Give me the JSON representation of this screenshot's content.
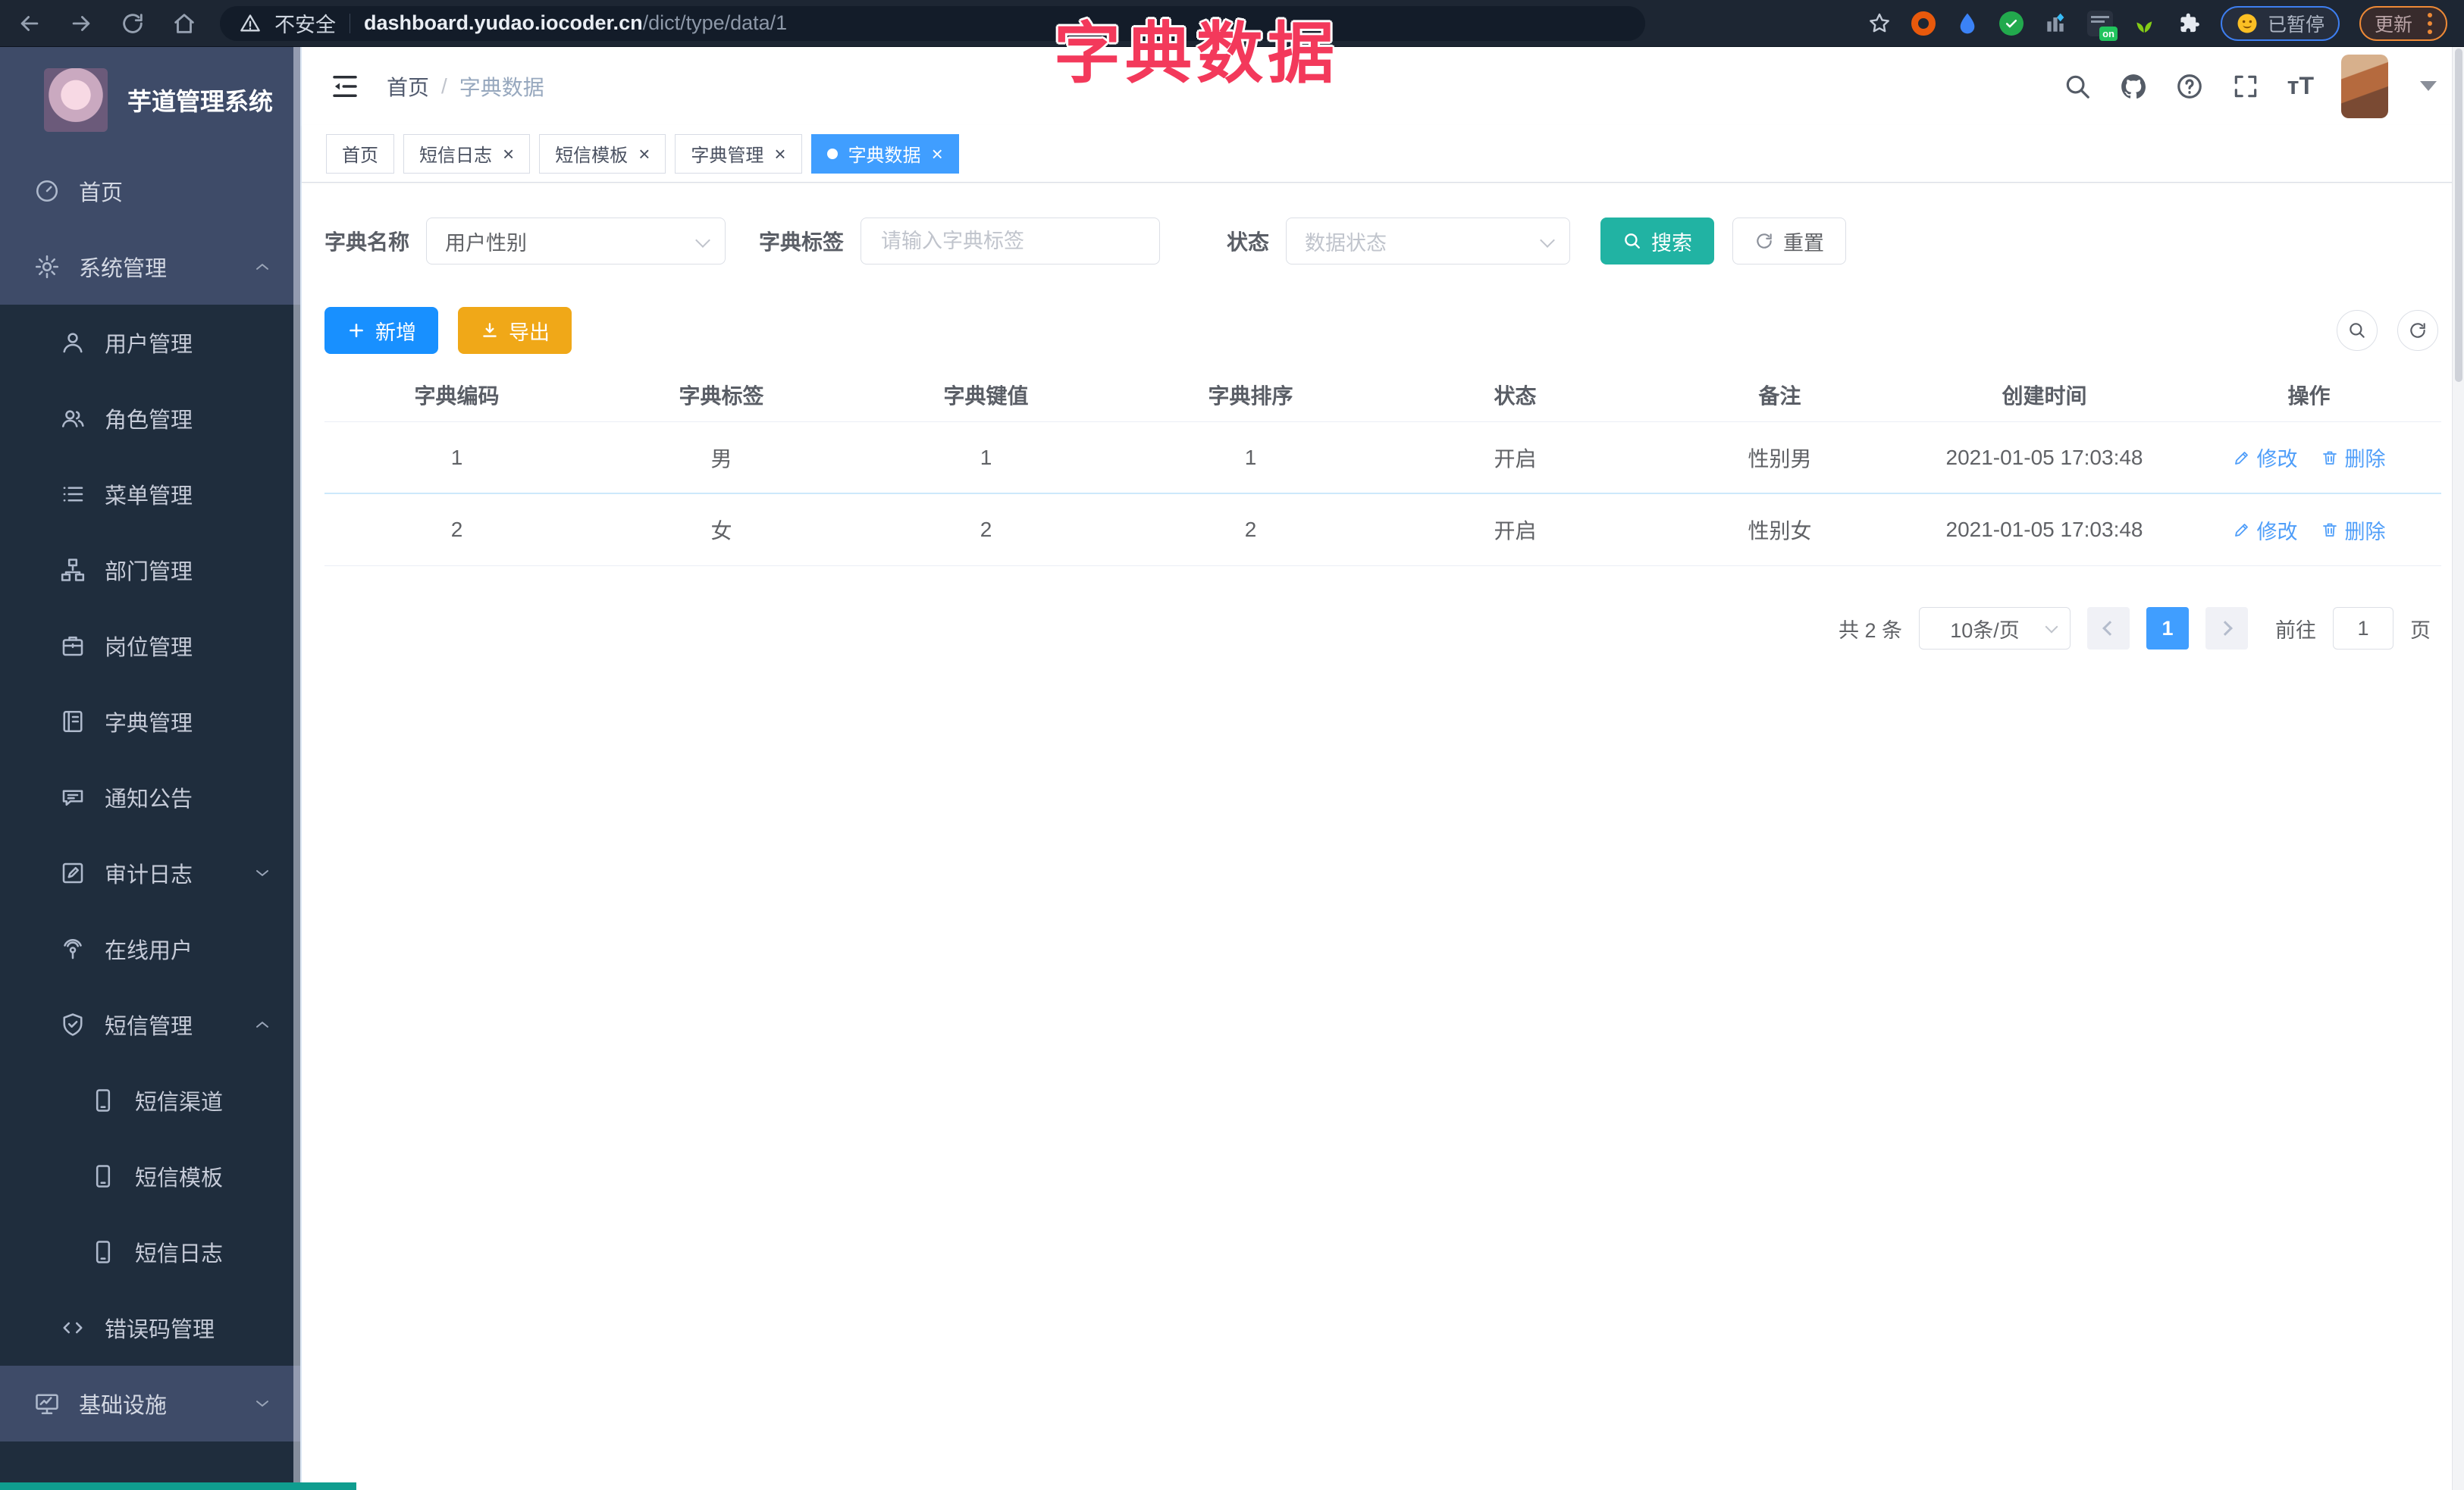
{
  "browser": {
    "security_label": "不安全",
    "url_domain": "dashboard.yudao.iocoder.cn",
    "url_path": "/dict/type/data/1",
    "paused_label": "已暂停",
    "update_label": "更新"
  },
  "overlay": {
    "title": "字典数据",
    "color": "#f3395b"
  },
  "sidebar": {
    "logo_title": "芋道管理系统",
    "items": [
      {
        "id": "home",
        "label": "首页",
        "icon": "gauge",
        "level": 1,
        "chevron": ""
      },
      {
        "id": "system-mgmt",
        "label": "系统管理",
        "icon": "gear",
        "level": 1,
        "chevron": "up"
      },
      {
        "id": "user-mgmt",
        "label": "用户管理",
        "icon": "user",
        "level": 2,
        "chevron": ""
      },
      {
        "id": "role-mgmt",
        "label": "角色管理",
        "icon": "users",
        "level": 2,
        "chevron": ""
      },
      {
        "id": "menu-mgmt",
        "label": "菜单管理",
        "icon": "list",
        "level": 2,
        "chevron": ""
      },
      {
        "id": "dept-mgmt",
        "label": "部门管理",
        "icon": "tree",
        "level": 2,
        "chevron": ""
      },
      {
        "id": "post-mgmt",
        "label": "岗位管理",
        "icon": "post",
        "level": 2,
        "chevron": ""
      },
      {
        "id": "dict-mgmt",
        "label": "字典管理",
        "icon": "dict",
        "level": 2,
        "chevron": ""
      },
      {
        "id": "notice",
        "label": "通知公告",
        "icon": "notice",
        "level": 2,
        "chevron": ""
      },
      {
        "id": "audit-log",
        "label": "审计日志",
        "icon": "audit",
        "level": 2,
        "chevron": "down"
      },
      {
        "id": "online-user",
        "label": "在线用户",
        "icon": "online",
        "level": 2,
        "chevron": ""
      },
      {
        "id": "sms-mgmt",
        "label": "短信管理",
        "icon": "sms",
        "level": 2,
        "chevron": "up"
      },
      {
        "id": "sms-channel",
        "label": "短信渠道",
        "icon": "phone",
        "level": 3,
        "chevron": ""
      },
      {
        "id": "sms-template",
        "label": "短信模板",
        "icon": "phone",
        "level": 3,
        "chevron": ""
      },
      {
        "id": "sms-log",
        "label": "短信日志",
        "icon": "phone",
        "level": 3,
        "chevron": ""
      },
      {
        "id": "errcode-mgmt",
        "label": "错误码管理",
        "icon": "code",
        "level": 2,
        "chevron": ""
      },
      {
        "id": "infrastructure",
        "label": "基础设施",
        "icon": "infra",
        "level": 1,
        "chevron": "down"
      }
    ]
  },
  "header": {
    "breadcrumb_home": "首页",
    "breadcrumb_sep": "/",
    "breadcrumb_current": "字典数据"
  },
  "tabs": {
    "items": [
      {
        "id": "home",
        "label": "首页",
        "closable": false,
        "active": false
      },
      {
        "id": "sms-log",
        "label": "短信日志",
        "closable": true,
        "active": false
      },
      {
        "id": "sms-template",
        "label": "短信模板",
        "closable": true,
        "active": false
      },
      {
        "id": "dict-mgmt",
        "label": "字典管理",
        "closable": true,
        "active": false
      },
      {
        "id": "dict-data",
        "label": "字典数据",
        "closable": true,
        "active": true
      }
    ]
  },
  "filters": {
    "dict_name_label": "字典名称",
    "dict_name_value": "用户性别",
    "dict_label_label": "字典标签",
    "dict_label_placeholder": "请输入字典标签",
    "status_label": "状态",
    "status_placeholder": "数据状态",
    "search_label": "搜索",
    "reset_label": "重置"
  },
  "toolbar": {
    "add_label": "新增",
    "export_label": "导出"
  },
  "table": {
    "columns": [
      "字典编码",
      "字典标签",
      "字典键值",
      "字典排序",
      "状态",
      "备注",
      "创建时间",
      "操作"
    ],
    "rows": [
      [
        "1",
        "男",
        "1",
        "1",
        "开启",
        "性别男",
        "2021-01-05 17:03:48"
      ],
      [
        "2",
        "女",
        "2",
        "2",
        "开启",
        "性别女",
        "2021-01-05 17:03:48"
      ]
    ],
    "edit_label": "修改",
    "delete_label": "删除"
  },
  "pagination": {
    "total_label": "共 2 条",
    "page_size": "10条/页",
    "current_page": "1",
    "goto_label": "前往",
    "goto_value": "1",
    "page_unit": "页"
  },
  "colors": {
    "accent_blue": "#1890ff",
    "active_tab_blue": "#409eff",
    "teal_search": "#21b3a3",
    "export_orange": "#f0a818",
    "overlay_red": "#f3395b",
    "sidebar_dark": "#1f2d3d",
    "sidebar_light": "#3e4b68",
    "link_blue": "#4f9ef9"
  }
}
